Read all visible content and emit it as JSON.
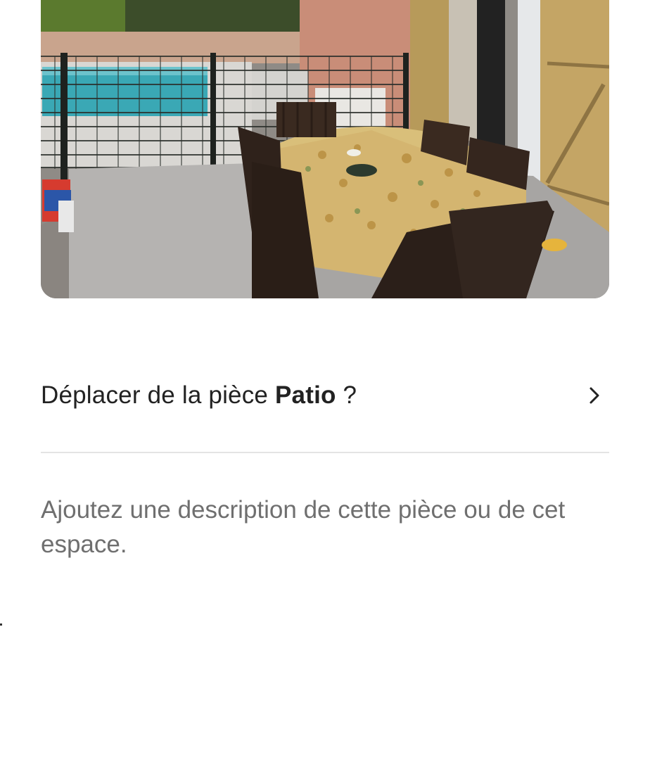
{
  "photo": {
    "name": "patio-photo"
  },
  "move_room": {
    "prefix": "Déplacer de la pièce ",
    "room": "Patio",
    "suffix": " ?",
    "icon": "chevron-right-icon"
  },
  "description": {
    "value": "",
    "placeholder": "Ajoutez une description de cette pièce ou de cet espace."
  },
  "colors": {
    "text": "#222222",
    "placeholder": "#6f6f6f",
    "divider": "#e4e4e4"
  }
}
